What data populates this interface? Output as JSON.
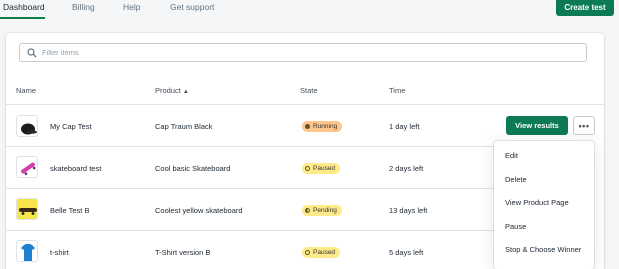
{
  "nav": {
    "tabs": [
      {
        "label": "Dashboard",
        "active": true
      },
      {
        "label": "Billing",
        "active": false
      },
      {
        "label": "Help",
        "active": false
      },
      {
        "label": "Get support",
        "active": false
      }
    ],
    "create_button": "Create test"
  },
  "search": {
    "placeholder": "Filter items",
    "icon": "search-icon"
  },
  "table": {
    "columns": [
      "Name",
      "Product",
      "State",
      "Time"
    ],
    "sort_indicator": "▲",
    "rows": [
      {
        "name": "My Cap Test",
        "product": "Cap Traum Black",
        "state": "Running",
        "state_type": "running",
        "time": "1 day left",
        "thumb": "cap"
      },
      {
        "name": "skateboard test",
        "product": "Cool basic Skateboard",
        "state": "Paused",
        "state_type": "paused",
        "time": "2 days left",
        "thumb": "skateboard-pink"
      },
      {
        "name": "Belle Test B",
        "product": "Coolest yellow skateboard",
        "state": "Pending",
        "state_type": "pending",
        "time": "13 days left",
        "thumb": "skateboard-yellow"
      },
      {
        "name": "t-shirt",
        "product": "T-Shirt version B",
        "state": "Paused",
        "state_type": "paused",
        "time": "5 days left",
        "thumb": "tshirt"
      }
    ],
    "view_results": "View results",
    "more": "•••"
  },
  "menu": {
    "items": [
      "Edit",
      "Delete",
      "View Product Page",
      "Pause",
      "Stop & Choose Winner"
    ]
  },
  "colors": {
    "primary": "#0c7b53",
    "running": "#ffc58b",
    "paused": "#ffea8a",
    "pending": "#ffea8a"
  }
}
